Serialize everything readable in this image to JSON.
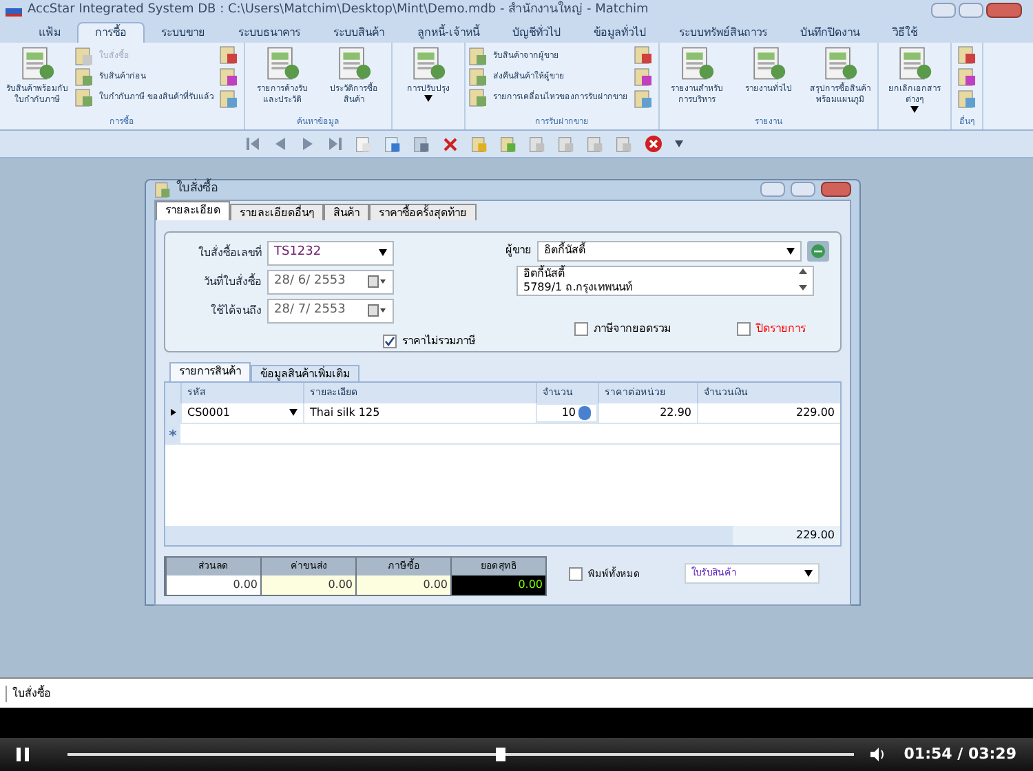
{
  "window": {
    "title": "AccStar Integrated System DB : C:\\Users\\Matchim\\Desktop\\Mint\\Demo.mdb - สำนักงานใหญ่ - Matchim"
  },
  "menu_tabs": [
    {
      "label": "แฟ้ม",
      "selected": false
    },
    {
      "label": "การซื้อ",
      "selected": true
    },
    {
      "label": "ระบบขาย",
      "selected": false
    },
    {
      "label": "ระบบธนาคาร",
      "selected": false
    },
    {
      "label": "ระบบสินค้า",
      "selected": false
    },
    {
      "label": "ลูกหนี้-เจ้าหนี้",
      "selected": false
    },
    {
      "label": "บัญชีทั่วไป",
      "selected": false
    },
    {
      "label": "ข้อมูลทั่วไป",
      "selected": false
    },
    {
      "label": "ระบบทรัพย์สินถาวร",
      "selected": false
    },
    {
      "label": "บันทึกปิดงาน",
      "selected": false
    },
    {
      "label": "วิธีใช้",
      "selected": false
    }
  ],
  "ribbon_groups": [
    {
      "label": "การซื้อ",
      "items": [
        {
          "kind": "large",
          "label": "รับสินค้าพร้อมกับใบกำกับภาษี"
        },
        {
          "kind": "small",
          "label": "ใบสั่งซื้อ",
          "disabled": true
        },
        {
          "kind": "small",
          "label": "รับสินค้าก่อน",
          "disabled": false
        },
        {
          "kind": "small",
          "label": "ใบกำกับภาษี ของสินค้าที่รับแล้ว",
          "disabled": false
        },
        {
          "kind": "icons"
        }
      ]
    },
    {
      "label": "ค้นหาข้อมูล",
      "items": [
        {
          "kind": "large",
          "label": "รายการค้างรับและประวัติ"
        },
        {
          "kind": "large",
          "label": "ประวัติการซื้อสินค้า"
        }
      ]
    },
    {
      "items": [
        {
          "kind": "dropdown",
          "label": "การปรับปรุง"
        }
      ]
    },
    {
      "label": "การรับฝากขาย",
      "items": [
        {
          "kind": "small",
          "label": "รับสินค้าจากผู้ขาย",
          "disabled": false
        },
        {
          "kind": "small",
          "label": "ส่งคืนสินค้าให้ผู้ขาย",
          "disabled": false
        },
        {
          "kind": "small",
          "label": "รายการเคลื่อนไหวของการรับฝากขาย",
          "disabled": false
        },
        {
          "kind": "icons"
        }
      ]
    },
    {
      "label": "รายงาน",
      "items": [
        {
          "kind": "large",
          "label": "รายงานสำหรับการบริหาร"
        },
        {
          "kind": "large",
          "label": "รายงานทั่วไป"
        },
        {
          "kind": "large",
          "label": "สรุปการซื้อสินค้าพร้อมแผนภูมิ"
        }
      ]
    },
    {
      "items": [
        {
          "kind": "dropdown",
          "label": "ยกเลิกเอกสารต่างๆ"
        }
      ]
    },
    {
      "label": "อื่นๆ",
      "items": [
        {
          "kind": "icons"
        }
      ]
    }
  ],
  "form": {
    "title": "ใบสั่งซื้อ",
    "tabs": [
      {
        "label": "รายละเอียด",
        "selected": true
      },
      {
        "label": "รายละเอียดอื่นๆ",
        "selected": false
      },
      {
        "label": "สินค้า",
        "selected": false
      },
      {
        "label": "ราคาซื้อครั้งสุดท้าย",
        "selected": false
      }
    ],
    "fields": [
      {
        "kind": "combo",
        "label": "ใบสั่งซื้อเลขที่",
        "value": "TS1232"
      },
      {
        "kind": "date",
        "label": "วันที่ใบสั่งซื้อ",
        "value": "28/ 6/ 2553"
      },
      {
        "kind": "date",
        "label": "ใช้ได้จนถึง",
        "value": "28/ 7/ 2553"
      }
    ],
    "vendor": {
      "label": "ผู้ขาย",
      "value": "อิตกี้นัสตี้",
      "address": [
        "อิตกี้นัสตี้",
        "5789/1 ถ.กรุงเทพนนท์"
      ]
    },
    "options": [
      {
        "label": "ราคาไม่รวมภาษี",
        "checked": true,
        "color": "#000000"
      },
      {
        "label": "ภาษีจากยอดรวม",
        "checked": false,
        "color": "#000000"
      },
      {
        "label": "ปิดรายการ",
        "checked": false,
        "color": "#ff0000"
      }
    ],
    "grid_tabs": [
      {
        "label": "รายการสินค้า",
        "selected": true
      },
      {
        "label": "ข้อมูลสินค้าเพิ่มเติม",
        "selected": false
      }
    ],
    "columns": [
      "รหัส",
      "รายละเอียด",
      "จำนวน",
      "ราคาต่อหน่วย",
      "จำนวนเงิน"
    ],
    "rows": [
      {
        "cells": [
          "CS0001",
          "Thai silk 125",
          "10",
          "22.90",
          "229.00"
        ]
      }
    ],
    "total": "229.00",
    "summary": [
      {
        "kind": "plain",
        "label": "ส่วนลด",
        "value": "0.00"
      },
      {
        "kind": "input",
        "label": "ค่าขนส่ง",
        "value": "0.00"
      },
      {
        "kind": "input",
        "label": "ภาษีซื้อ",
        "value": "0.00"
      },
      {
        "kind": "net",
        "label": "ยอดสุทธิ",
        "value": "0.00"
      }
    ],
    "print_all": {
      "label": "พิมพ์ทั้งหมด",
      "checked": false
    },
    "report": {
      "value": "ใบรับสินค้า"
    }
  },
  "status_bar": "ใบสั่งซื้อ",
  "player": {
    "playing": true,
    "level": 0.55,
    "time": "01:54 / 03:29"
  }
}
